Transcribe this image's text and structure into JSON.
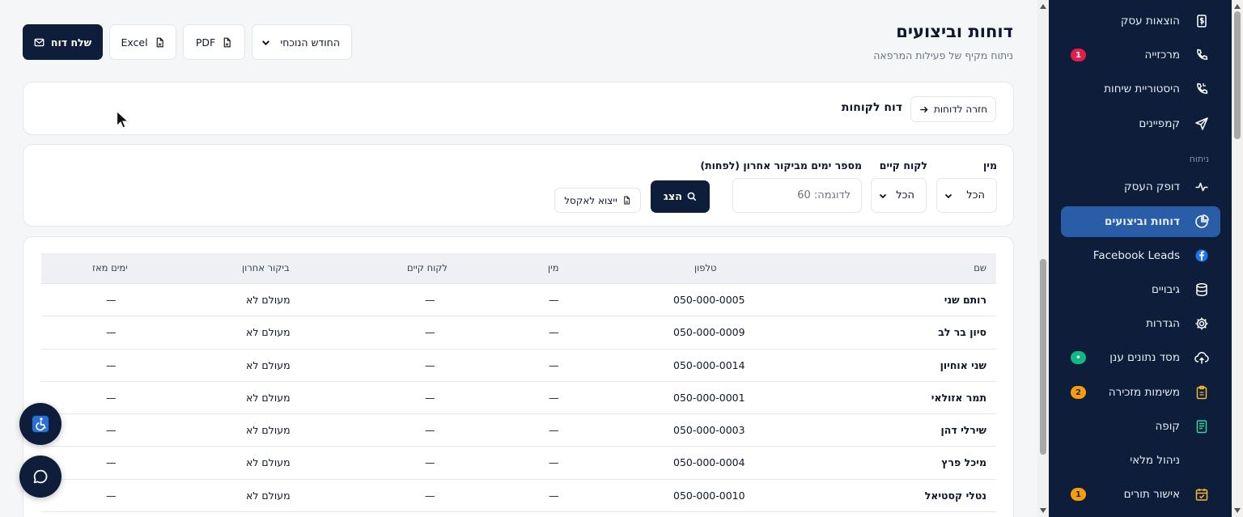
{
  "header": {
    "title": "דוחות וביצועים",
    "subtitle": "ניתוח מקיף של פעילות המרפאה"
  },
  "toolbar": {
    "send_report": "שלח דוח",
    "excel": "Excel",
    "pdf": "PDF",
    "period": "החודש הנוכחי"
  },
  "report": {
    "back": "חזרה לדוחות",
    "title": "דוח לקוחות"
  },
  "filters": {
    "gender_label": "מין",
    "gender_value": "הכל",
    "existing_label": "לקוח קיים",
    "existing_value": "הכל",
    "days_label": "מספר ימים מביקור אחרון (לפחות)",
    "days_placeholder": "לדוגמה: 60",
    "show": "הצג",
    "export": "ייצוא לאקסל"
  },
  "table": {
    "headers": {
      "name": "שם",
      "phone": "טלפון",
      "gender": "מין",
      "existing": "לקוח קיים",
      "last_visit": "ביקור אחרון",
      "days_since": "ימים מאז"
    },
    "rows": [
      {
        "name": "רותם שני",
        "phone": "050-000-0005",
        "gender": "—",
        "existing": "—",
        "last_visit": "מעולם לא",
        "days_since": "—"
      },
      {
        "name": "סיון בר לב",
        "phone": "050-000-0009",
        "gender": "—",
        "existing": "—",
        "last_visit": "מעולם לא",
        "days_since": "—"
      },
      {
        "name": "שני אוחיון",
        "phone": "050-000-0014",
        "gender": "—",
        "existing": "—",
        "last_visit": "מעולם לא",
        "days_since": "—"
      },
      {
        "name": "תמר אזולאי",
        "phone": "050-000-0001",
        "gender": "—",
        "existing": "—",
        "last_visit": "מעולם לא",
        "days_since": "—"
      },
      {
        "name": "שירלי דהן",
        "phone": "050-000-0003",
        "gender": "—",
        "existing": "—",
        "last_visit": "מעולם לא",
        "days_since": "—"
      },
      {
        "name": "מיכל פרץ",
        "phone": "050-000-0004",
        "gender": "—",
        "existing": "—",
        "last_visit": "מעולם לא",
        "days_since": "—"
      },
      {
        "name": "נטלי קסטיאל",
        "phone": "050-000-0010",
        "gender": "—",
        "existing": "—",
        "last_visit": "מעולם לא",
        "days_since": "—"
      }
    ]
  },
  "sidebar": {
    "section_analysis": "ניתוח",
    "items": [
      {
        "label": "הוצאות עסק",
        "icon": "dollar-receipt-icon"
      },
      {
        "label": "מרכזייה",
        "icon": "phone-icon",
        "badge": "1"
      },
      {
        "label": "היסטוריית שיחות",
        "icon": "phone-history-icon"
      },
      {
        "label": "קמפיינים",
        "icon": "send-icon"
      },
      {
        "label": "דופק העסק",
        "icon": "pulse-icon"
      },
      {
        "label": "דוחות וביצועים",
        "icon": "pie-chart-icon"
      },
      {
        "label": "Facebook Leads",
        "icon": "facebook-icon"
      },
      {
        "label": "גיבויים",
        "icon": "database-icon"
      },
      {
        "label": "הגדרות",
        "icon": "gear-icon"
      },
      {
        "label": "מסד נתונים ענן",
        "icon": "cloud-upload-icon",
        "badge": "•"
      },
      {
        "label": "משימות מזכירה",
        "icon": "clipboard-icon",
        "badge": "2"
      },
      {
        "label": "קופה",
        "icon": "register-icon"
      },
      {
        "label": "ניהול מלאי",
        "icon": ""
      },
      {
        "label": "אישור תורים",
        "icon": "calendar-check-icon",
        "badge": "1"
      }
    ]
  },
  "colors": {
    "sidebar_bg": "#0e1e3a",
    "active_item": "#2a5da8",
    "primary_button": "#0e1e3a",
    "badge_red": "#e11d48",
    "badge_green": "#10b981",
    "badge_amber": "#f59e0b"
  }
}
